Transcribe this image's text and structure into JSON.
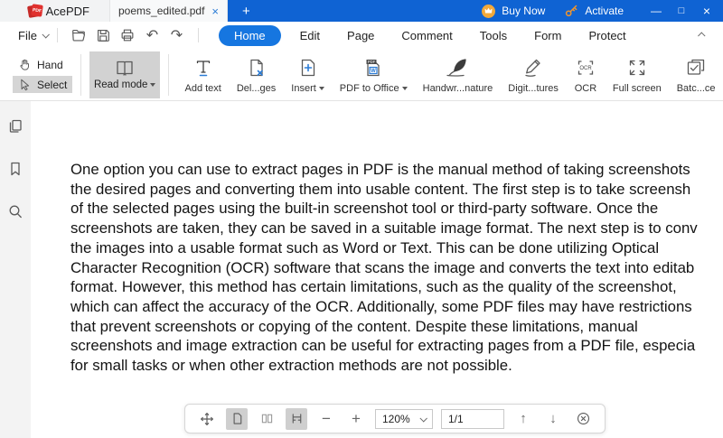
{
  "window": {
    "app_name": "AcePDF",
    "logo_text": "PDF",
    "tab_title": "poems_edited.pdf",
    "tab_close": "×",
    "new_tab": "+",
    "buy_now_label": "Buy Now",
    "activate_label": "Activate",
    "minimize": "—",
    "maximize": "□",
    "close": "×"
  },
  "menubar": {
    "file_label": "File",
    "nav": [
      {
        "label": "Home",
        "active": true
      },
      {
        "label": "Edit"
      },
      {
        "label": "Page"
      },
      {
        "label": "Comment"
      },
      {
        "label": "Tools"
      },
      {
        "label": "Form"
      },
      {
        "label": "Protect"
      }
    ]
  },
  "ribbon": {
    "hand_label": "Hand",
    "select_label": "Select",
    "read_mode_label": "Read mode",
    "add_text_label": "Add text",
    "delete_pages_label": "Del...ges",
    "insert_label": "Insert",
    "pdf_to_office_label": "PDF to Office",
    "handwritten_signature_label": "Handwr...nature",
    "digital_signatures_label": "Digit...tures",
    "ocr_label": "OCR",
    "full_screen_label": "Full screen",
    "batch_process_label": "Batc...ce"
  },
  "icons": {
    "undo": "↶",
    "redo": "↷",
    "up_arrow": "↑",
    "down_arrow": "↓",
    "zoom_out": "−",
    "zoom_in": "+",
    "pdf_badge": "PDF",
    "word_badge": "W",
    "ocr_text": "OCR"
  },
  "document": {
    "lines": [
      "One option you can use to extract pages in PDF is the manual method of taking screenshots",
      "the desired pages and converting them into usable content. The first step is to take screensh",
      "of the selected pages using the built-in screenshot tool or third-party software. Once the",
      "screenshots are taken, they can be saved in a suitable image format. The next step is to conv",
      "the images into a usable format such as Word or Text. This can be done utilizing Optical",
      "Character Recognition (OCR) software that scans the image and converts the text into editab",
      "format. However, this method has certain limitations, such as the quality of the screenshot,",
      "which can affect the accuracy of the OCR. Additionally, some PDF files may have restrictions",
      "that prevent screenshots or copying of the content. Despite these limitations, manual",
      "screenshots and image extraction can be useful for extracting pages from a PDF file, especia",
      "for small tasks or when other extraction methods are not possible."
    ]
  },
  "viewbar": {
    "zoom_value": "120%",
    "page_value": "1/1"
  },
  "colors": {
    "titlebar_blue": "#0f63d3",
    "active_pill_blue": "#1676e0",
    "accent_blue": "#2b7cd6",
    "selected_gray": "#d2d2d2",
    "logo_red": "#e0312e"
  }
}
